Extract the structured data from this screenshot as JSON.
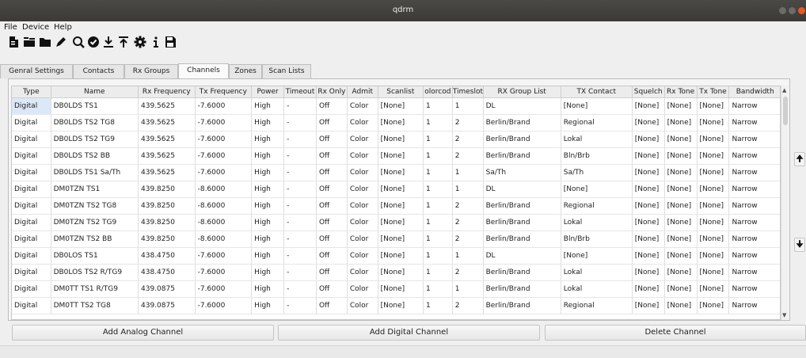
{
  "window": {
    "title": "qdrm"
  },
  "menu": [
    "File",
    "Device",
    "Help"
  ],
  "toolbar": {
    "icons": [
      "new-file-icon",
      "open-list-icon",
      "open-folder-icon",
      "edit-pencil-icon",
      "search-icon",
      "verify-icon",
      "download-icon",
      "upload-icon",
      "settings-gear-icon",
      "info-icon",
      "save-icon"
    ]
  },
  "tabs": [
    "Genral Settings",
    "Contacts",
    "Rx Groups",
    "Channels",
    "Zones",
    "Scan Lists"
  ],
  "active_tab": "Channels",
  "table": {
    "columns": [
      "Type",
      "Name",
      "Rx Frequency",
      "Tx Frequency",
      "Power",
      "Timeout",
      "Rx Only",
      "Admit",
      "Scanlist",
      "olorcod",
      "Timeslot",
      "RX Group List",
      "TX Contact",
      "Squelch",
      "Rx Tone",
      "Tx Tone",
      "Bandwidth"
    ],
    "rows": [
      [
        "Digital",
        "DB0LDS TS1",
        "439.5625",
        "-7.6000",
        "High",
        "-",
        "Off",
        "Color",
        "[None]",
        "1",
        "1",
        "DL",
        "[None]",
        "[None]",
        "[None]",
        "[None]",
        "Narrow"
      ],
      [
        "Digital",
        "DB0LDS TS2 TG8",
        "439.5625",
        "-7.6000",
        "High",
        "-",
        "Off",
        "Color",
        "[None]",
        "1",
        "2",
        "Berlin/Brand",
        "Regional",
        "[None]",
        "[None]",
        "[None]",
        "Narrow"
      ],
      [
        "Digital",
        "DB0LDS TS2 TG9",
        "439.5625",
        "-7.6000",
        "High",
        "-",
        "Off",
        "Color",
        "[None]",
        "1",
        "2",
        "Berlin/Brand",
        "Lokal",
        "[None]",
        "[None]",
        "[None]",
        "Narrow"
      ],
      [
        "Digital",
        "DB0LDS TS2 BB",
        "439.5625",
        "-7.6000",
        "High",
        "-",
        "Off",
        "Color",
        "[None]",
        "1",
        "2",
        "Berlin/Brand",
        "Bln/Brb",
        "[None]",
        "[None]",
        "[None]",
        "Narrow"
      ],
      [
        "Digital",
        "DB0LDS TS1 Sa/Th",
        "439.5625",
        "-7.6000",
        "High",
        "-",
        "Off",
        "Color",
        "[None]",
        "1",
        "1",
        "Sa/Th",
        "Sa/Th",
        "[None]",
        "[None]",
        "[None]",
        "Narrow"
      ],
      [
        "Digital",
        "DM0TZN TS1",
        "439.8250",
        "-8.6000",
        "High",
        "-",
        "Off",
        "Color",
        "[None]",
        "1",
        "1",
        "DL",
        "[None]",
        "[None]",
        "[None]",
        "[None]",
        "Narrow"
      ],
      [
        "Digital",
        "DM0TZN TS2 TG8",
        "439.8250",
        "-8.6000",
        "High",
        "-",
        "Off",
        "Color",
        "[None]",
        "1",
        "2",
        "Berlin/Brand",
        "Regional",
        "[None]",
        "[None]",
        "[None]",
        "Narrow"
      ],
      [
        "Digital",
        "DM0TZN TS2 TG9",
        "439.8250",
        "-8.6000",
        "High",
        "-",
        "Off",
        "Color",
        "[None]",
        "1",
        "2",
        "Berlin/Brand",
        "Lokal",
        "[None]",
        "[None]",
        "[None]",
        "Narrow"
      ],
      [
        "Digital",
        "DM0TZN TS2 BB",
        "439.8250",
        "-8.6000",
        "High",
        "-",
        "Off",
        "Color",
        "[None]",
        "1",
        "2",
        "Berlin/Brand",
        "Bln/Brb",
        "[None]",
        "[None]",
        "[None]",
        "Narrow"
      ],
      [
        "Digital",
        "DB0LOS TS1",
        "438.4750",
        "-7.6000",
        "High",
        "-",
        "Off",
        "Color",
        "[None]",
        "1",
        "1",
        "DL",
        "[None]",
        "[None]",
        "[None]",
        "[None]",
        "Narrow"
      ],
      [
        "Digital",
        "DB0LOS TS2 R/TG9",
        "438.4750",
        "-7.6000",
        "High",
        "-",
        "Off",
        "Color",
        "[None]",
        "1",
        "2",
        "Berlin/Brand",
        "Lokal",
        "[None]",
        "[None]",
        "[None]",
        "Narrow"
      ],
      [
        "Digital",
        "DM0TT TS1 R/TG9",
        "439.0875",
        "-7.6000",
        "High",
        "-",
        "Off",
        "Color",
        "[None]",
        "1",
        "1",
        "Berlin/Brand",
        "Lokal",
        "[None]",
        "[None]",
        "[None]",
        "Narrow"
      ],
      [
        "Digital",
        "DM0TT TS2 TG8",
        "439.0875",
        "-7.6000",
        "High",
        "-",
        "Off",
        "Color",
        "[None]",
        "1",
        "2",
        "Berlin/Brand",
        "Regional",
        "[None]",
        "[None]",
        "[None]",
        "Narrow"
      ]
    ]
  },
  "side_buttons": {
    "move_up": "🠉",
    "move_down": "🠋"
  },
  "buttons": {
    "add_analog": "Add Analog Channel",
    "add_digital": "Add Digital Channel",
    "delete": "Delete Channel"
  },
  "colors": {
    "titlebar": "#3e3d3a",
    "close": "#e8581f",
    "selected_cell": "#dbe8f7"
  }
}
